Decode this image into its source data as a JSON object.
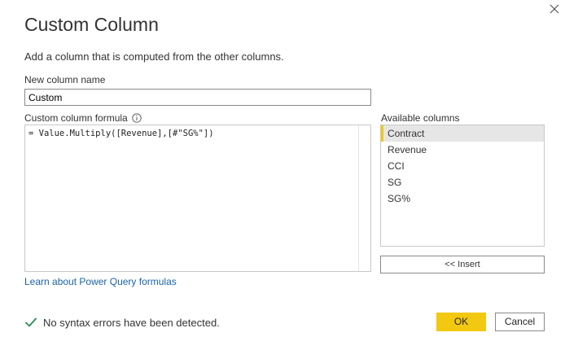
{
  "dialog": {
    "title": "Custom Column",
    "description": "Add a column that is computed from the other columns."
  },
  "new_column": {
    "label": "New column name",
    "value": "Custom"
  },
  "formula": {
    "label": "Custom column formula",
    "info_icon": "info-icon",
    "value": "= Value.Multiply([Revenue],[#\"SG%\"])"
  },
  "available_columns": {
    "label": "Available columns",
    "items": [
      {
        "label": "Contract",
        "selected": true
      },
      {
        "label": "Revenue",
        "selected": false
      },
      {
        "label": "CCI",
        "selected": false
      },
      {
        "label": "SG",
        "selected": false
      },
      {
        "label": "SG%",
        "selected": false
      }
    ],
    "insert_label": "<< Insert"
  },
  "learn_link": "Learn about Power Query formulas",
  "status": {
    "icon": "checkmark-icon",
    "text": "No syntax errors have been detected."
  },
  "buttons": {
    "ok": "OK",
    "cancel": "Cancel"
  },
  "colors": {
    "accent": "#f2c811",
    "link": "#1a63a8",
    "success": "#2e8b57",
    "selected_bg": "#e6e6e6"
  }
}
